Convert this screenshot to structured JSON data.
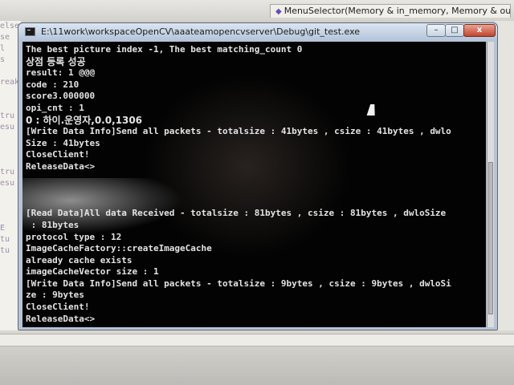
{
  "background": {
    "ide_tab_label": "MenuSelector(Memory & in_memory, Memory & out_memory",
    "left_snippets": [
      "else",
      "se",
      "l",
      "s",
      "",
      "reak",
      "",
      "",
      "tru",
      "esu",
      "",
      "",
      "",
      "tru",
      "esu",
      "",
      "",
      "",
      "E",
      "tu",
      "tu"
    ]
  },
  "console": {
    "title": "E:\\11work\\workspaceOpenCV\\aaateamopencvserver\\Debug\\git_test.exe",
    "buttons": {
      "minimize": "–",
      "maximize": "□",
      "close": "x"
    },
    "lines": [
      "The best picture index -1, The best matching_count 0",
      "상점 등록 성공",
      "result: 1 @@@",
      "code : 210",
      "score3.000000",
      "opi_cnt : 1",
      "0 : 하이.운영자,0.0,1306",
      "[Write Data Info]Send all packets - totalsize : 41bytes , csize : 41bytes , dwlo",
      "Size : 41bytes",
      "CloseClient!",
      "ReleaseData<>",
      "",
      "",
      "",
      "[Read Data]All data Received - totalsize : 81bytes , csize : 81bytes , dwloSize",
      " : 81bytes",
      "protocol type : 12",
      "ImageCacheFactory::createImageCache",
      "already cache exists",
      "imageCacheVector size : 1",
      "[Write Data Info]Send all packets - totalsize : 9bytes , csize : 9bytes , dwloSi",
      "ze : 9bytes",
      "CloseClient!",
      "ReleaseData<>"
    ]
  },
  "colors": {
    "console_bg": "#030303",
    "console_text": "#e4e4e4",
    "close_button": "#c2452e"
  }
}
